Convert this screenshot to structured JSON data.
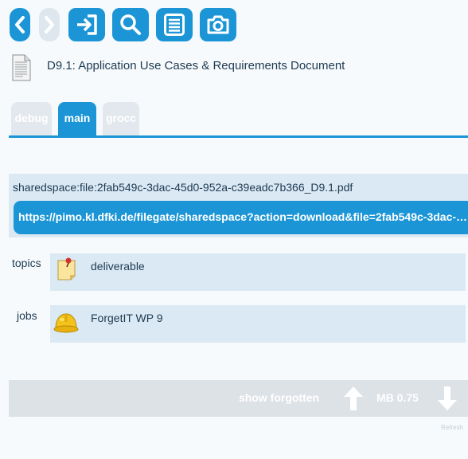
{
  "toolbar": {
    "back_icon": "chevron-left-icon",
    "forward_icon": "chevron-right-icon",
    "import_icon": "sign-in-icon",
    "search_icon": "search-icon",
    "list_icon": "list-icon",
    "camera_icon": "camera-icon",
    "accent_color": "#1b95d6",
    "disabled_color": "#dfe7ee"
  },
  "document": {
    "icon": "document-icon",
    "title": "D9.1: Application Use Cases & Requirements Document"
  },
  "tabs": [
    {
      "label": "debug",
      "active": false
    },
    {
      "label": "main",
      "active": true
    },
    {
      "label": "grocc",
      "active": false
    }
  ],
  "file": {
    "identifier": "sharedspace:file:2fab549c-3dac-45d0-952a-c39eadc7b366_D9.1.pdf",
    "url": "https://pimo.kl.dfki.de/filegate/sharedspace?action=download&file=2fab549c-3dac-45d0-952a-c39eadc7b366_D9.1.pdf"
  },
  "properties": {
    "topics": {
      "label": "topics",
      "icon": "sticky-note-icon",
      "value": "deliverable"
    },
    "jobs": {
      "label": "jobs",
      "icon": "hard-hat-icon",
      "value": "ForgetIT WP 9"
    }
  },
  "footer": {
    "show_forgotten_label": "show forgotten",
    "up_icon": "arrow-up-icon",
    "mb_value": "MB 0.75",
    "down_icon": "arrow-down-icon",
    "refresh_label": "Refresh"
  }
}
